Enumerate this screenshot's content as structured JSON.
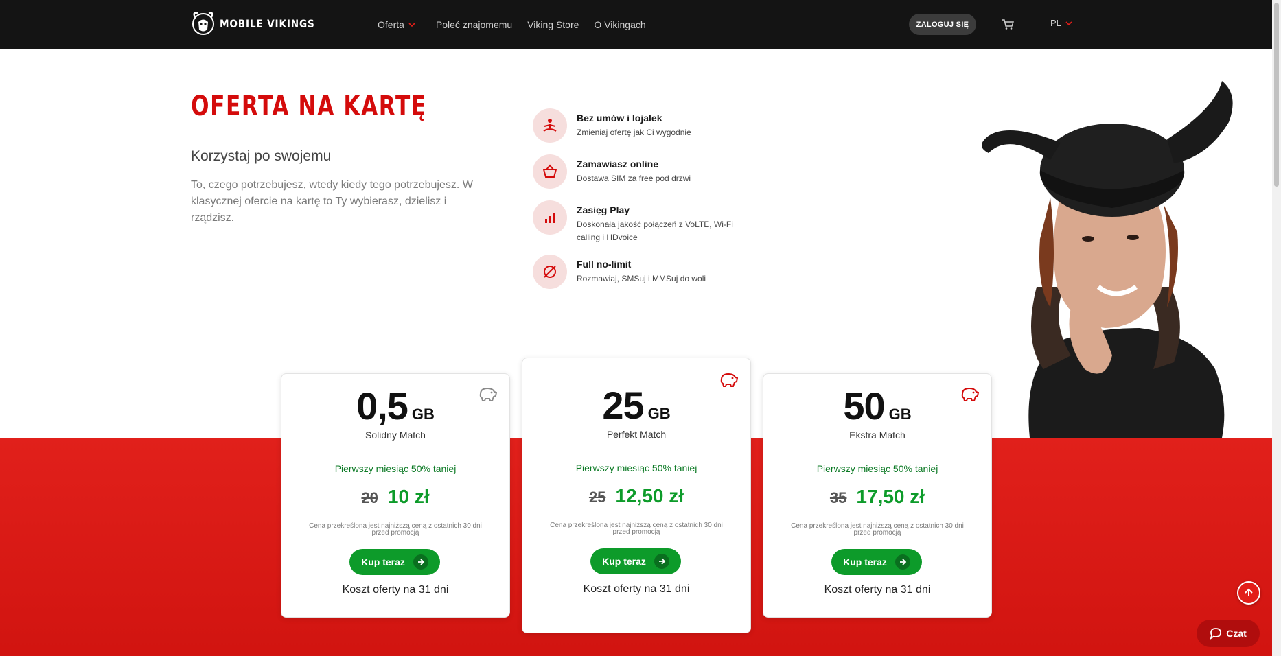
{
  "nav": {
    "brand": "MOBILE VIKINGS",
    "links": [
      "Oferta",
      "Poleć znajomemu",
      "Viking Store",
      "O Vikingach"
    ],
    "login_label": "ZALOGUJ SIĘ",
    "lang": "PL"
  },
  "hero": {
    "title": "OFERTA NA KARTĘ",
    "subtitle": "Korzystaj po swojemu",
    "description": "To, czego potrzebujesz, wtedy kiedy tego potrzebujesz. W klasycznej ofercie na kartę to Ty wybierasz, dzielisz i rządzisz."
  },
  "features": [
    {
      "title": "Bez umów i lojalek",
      "desc": "Zmieniaj ofertę jak Ci wygodnie",
      "icon": "meditation-icon"
    },
    {
      "title": "Zamawiasz online",
      "desc": "Dostawa SIM za free pod drzwi",
      "icon": "basket-icon"
    },
    {
      "title": "Zasięg Play",
      "desc": "Doskonała jakość połączeń z VoLTE, Wi-Fi calling i HDvoice",
      "icon": "signal-bars-icon"
    },
    {
      "title": "Full no-limit",
      "desc": "Rozmawiaj, SMSuj i MMSuj do woli",
      "icon": "no-limit-icon"
    }
  ],
  "plans": [
    {
      "gb": "0,5",
      "unit": "GB",
      "name": "Solidny Match",
      "promo": "Pierwszy miesiąc 50% taniej",
      "old_price": "20",
      "new_price": "10 zł",
      "fine": "Cena przekreślona jest najniższą ceną z ostatnich 30 dni przed promocją",
      "buy": "Kup teraz",
      "cost": "Koszt oferty na 31 dni",
      "piggy_color": "#8a8a8a"
    },
    {
      "gb": "25",
      "unit": "GB",
      "name": "Perfekt Match",
      "promo": "Pierwszy miesiąc 50% taniej",
      "old_price": "25",
      "new_price": "12,50 zł",
      "fine": "Cena przekreślona jest najniższą ceną z ostatnich 30 dni przed promocją",
      "buy": "Kup teraz",
      "cost": "Koszt oferty na 31 dni",
      "piggy_color": "#d40b0b"
    },
    {
      "gb": "50",
      "unit": "GB",
      "name": "Ekstra Match",
      "promo": "Pierwszy miesiąc 50% taniej",
      "old_price": "35",
      "new_price": "17,50 zł",
      "fine": "Cena przekreślona jest najniższą ceną z ostatnich 30 dni przed promocją",
      "buy": "Kup teraz",
      "cost": "Koszt oferty na 31 dni",
      "piggy_color": "#d40b0b"
    }
  ],
  "chat_label": "Czat",
  "colors": {
    "accent_red": "#d40b0b",
    "green": "#0d9b2a",
    "nav_bg": "#141414"
  }
}
